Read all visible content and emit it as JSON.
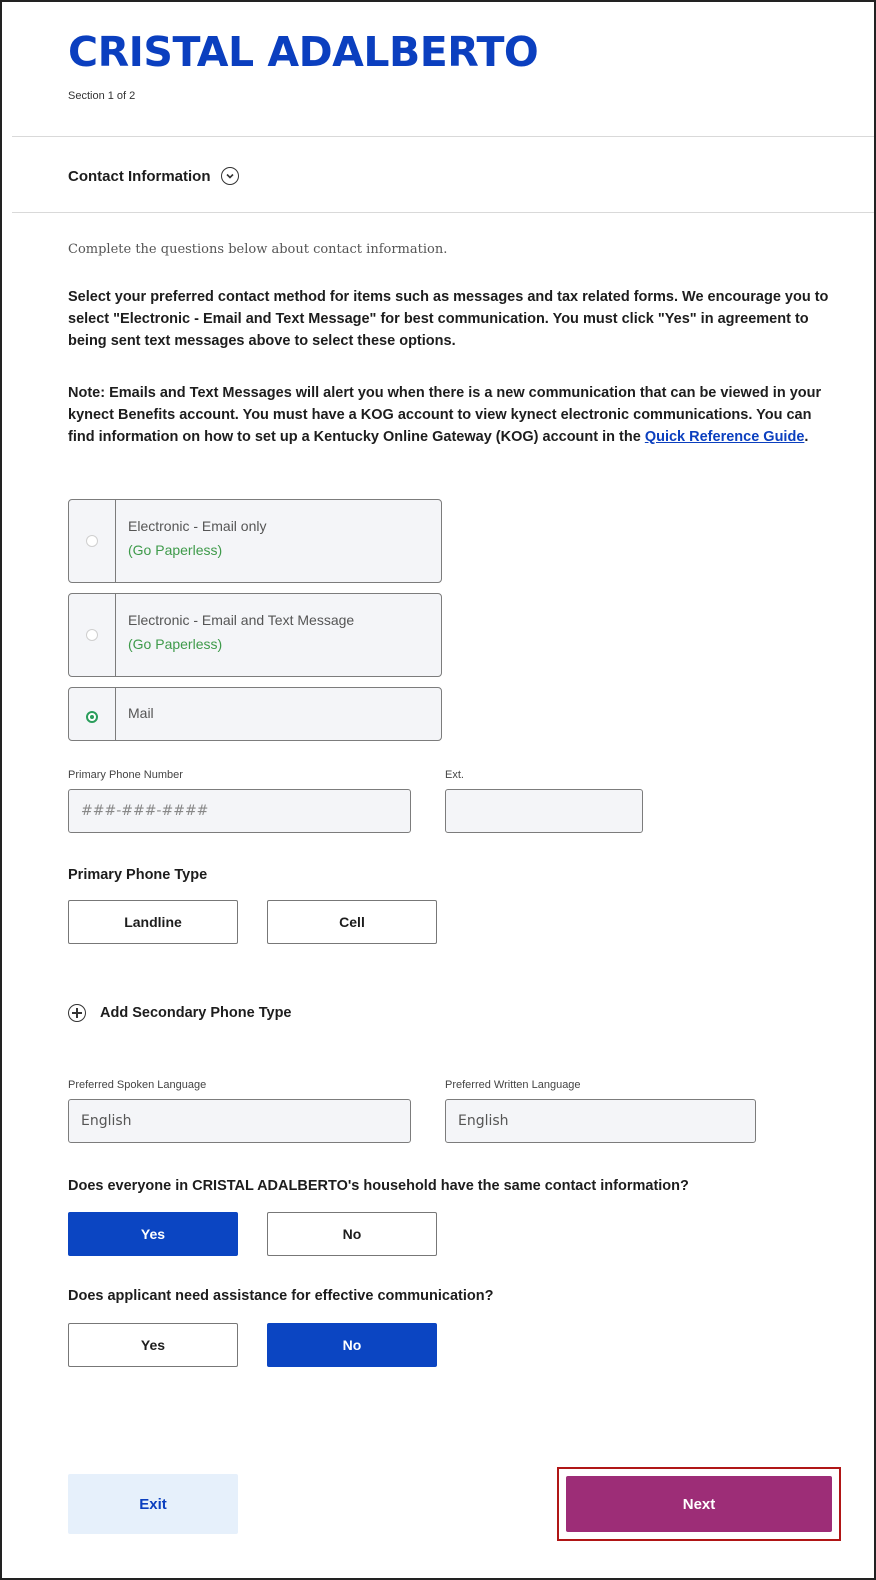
{
  "header": {
    "title": "CRISTAL ADALBERTO",
    "section_indicator": "Section 1 of 2"
  },
  "section": {
    "title": "Contact Information",
    "toggle_icon": "chevron-down-icon"
  },
  "intro": "Complete the questions below about contact information.",
  "instructions": "Select your preferred contact method for items such as messages and tax related forms. We encourage you to select \"Electronic - Email and Text Message\" for best communication. You must click \"Yes\" in agreement to being sent text messages above to select these options.",
  "note": {
    "text": "Note: Emails and Text Messages will alert you when there is a new communication that can be viewed in your kynect Benefits account. You must have a KOG account to view kynect electronic communications. You can find information on how to set up a Kentucky Online Gateway (KOG) account in the ",
    "link": "Quick Reference Guide",
    "end": "."
  },
  "contact_methods": [
    {
      "label": "Electronic - Email only",
      "sub": "(Go Paperless)",
      "selected": false
    },
    {
      "label": "Electronic - Email and Text Message",
      "sub": "(Go Paperless)",
      "selected": false
    },
    {
      "label": "Mail",
      "sub": "",
      "selected": true
    }
  ],
  "phone": {
    "label": "Primary Phone Number",
    "placeholder": "###-###-####",
    "ext_label": "Ext.",
    "ext_value": ""
  },
  "phone_type": {
    "label": "Primary Phone Type",
    "options": [
      "Landline",
      "Cell"
    ]
  },
  "add_secondary": "Add Secondary Phone Type",
  "languages": {
    "spoken_label": "Preferred Spoken Language",
    "spoken_value": "English",
    "written_label": "Preferred Written Language",
    "written_value": "English"
  },
  "q_household": {
    "question": "Does everyone in CRISTAL ADALBERTO's household have the same contact information?",
    "yes": "Yes",
    "no": "No",
    "selected": "Yes"
  },
  "q_assistance": {
    "question": "Does applicant need assistance for effective communication?",
    "yes": "Yes",
    "no": "No",
    "selected": "No"
  },
  "footer": {
    "exit": "Exit",
    "next": "Next"
  },
  "colors": {
    "brand_blue": "#0b3fbf",
    "next_purple": "#9d2d77",
    "highlight_red": "#b01616",
    "paperless_green": "#3e9a4a"
  }
}
